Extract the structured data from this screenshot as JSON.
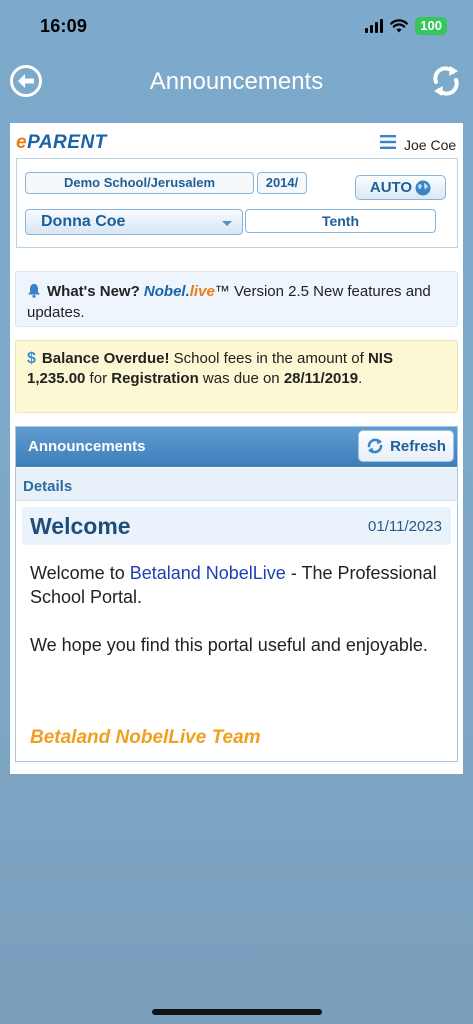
{
  "status": {
    "time": "16:09",
    "battery": "100"
  },
  "header": {
    "title": "Announcements"
  },
  "topbar": {
    "logo_e": "e",
    "logo_text": "PARENT",
    "user": "Joe Coe"
  },
  "selectors": {
    "school": "Demo School/Jerusalem",
    "year": "2014/",
    "auto_label": "AUTO",
    "student": "Donna Coe",
    "grade": "Tenth"
  },
  "whats_new": {
    "lead": "What's New?",
    "brand_a": "Nobel.",
    "brand_b": "live",
    "tm": "™",
    "text": " Version 2.5 New features and updates."
  },
  "balance": {
    "symbol": "$",
    "lead": "Balance Overdue!",
    "t1": " School fees in the amount of ",
    "amount": "NIS 1,235.00",
    "t2": " for ",
    "item": "Registration",
    "t3": " was due on ",
    "date": "28/11/2019",
    "t4": "."
  },
  "announcements": {
    "heading": "Announcements",
    "refresh_label": "Refresh",
    "details_label": "Details",
    "item": {
      "title": "Welcome",
      "date": "01/11/2023",
      "p1_a": "Welcome to ",
      "p1_link": "Betaland NobelLive",
      "p1_b": " - The Professional School Portal.",
      "p2": "We hope you find this portal useful and enjoyable.",
      "signature": "Betaland NobelLive Team"
    }
  },
  "colors": {
    "accent": "#3d7fbb",
    "brand_orange": "#e47f15",
    "warning_bg": "#fbf8d3",
    "info_bg": "#eef5fc"
  },
  "icons": [
    "back-arrow-icon",
    "refresh-icon",
    "menu-icon",
    "globe-icon",
    "bell-icon",
    "dollar-icon",
    "chevron-down-icon"
  ]
}
